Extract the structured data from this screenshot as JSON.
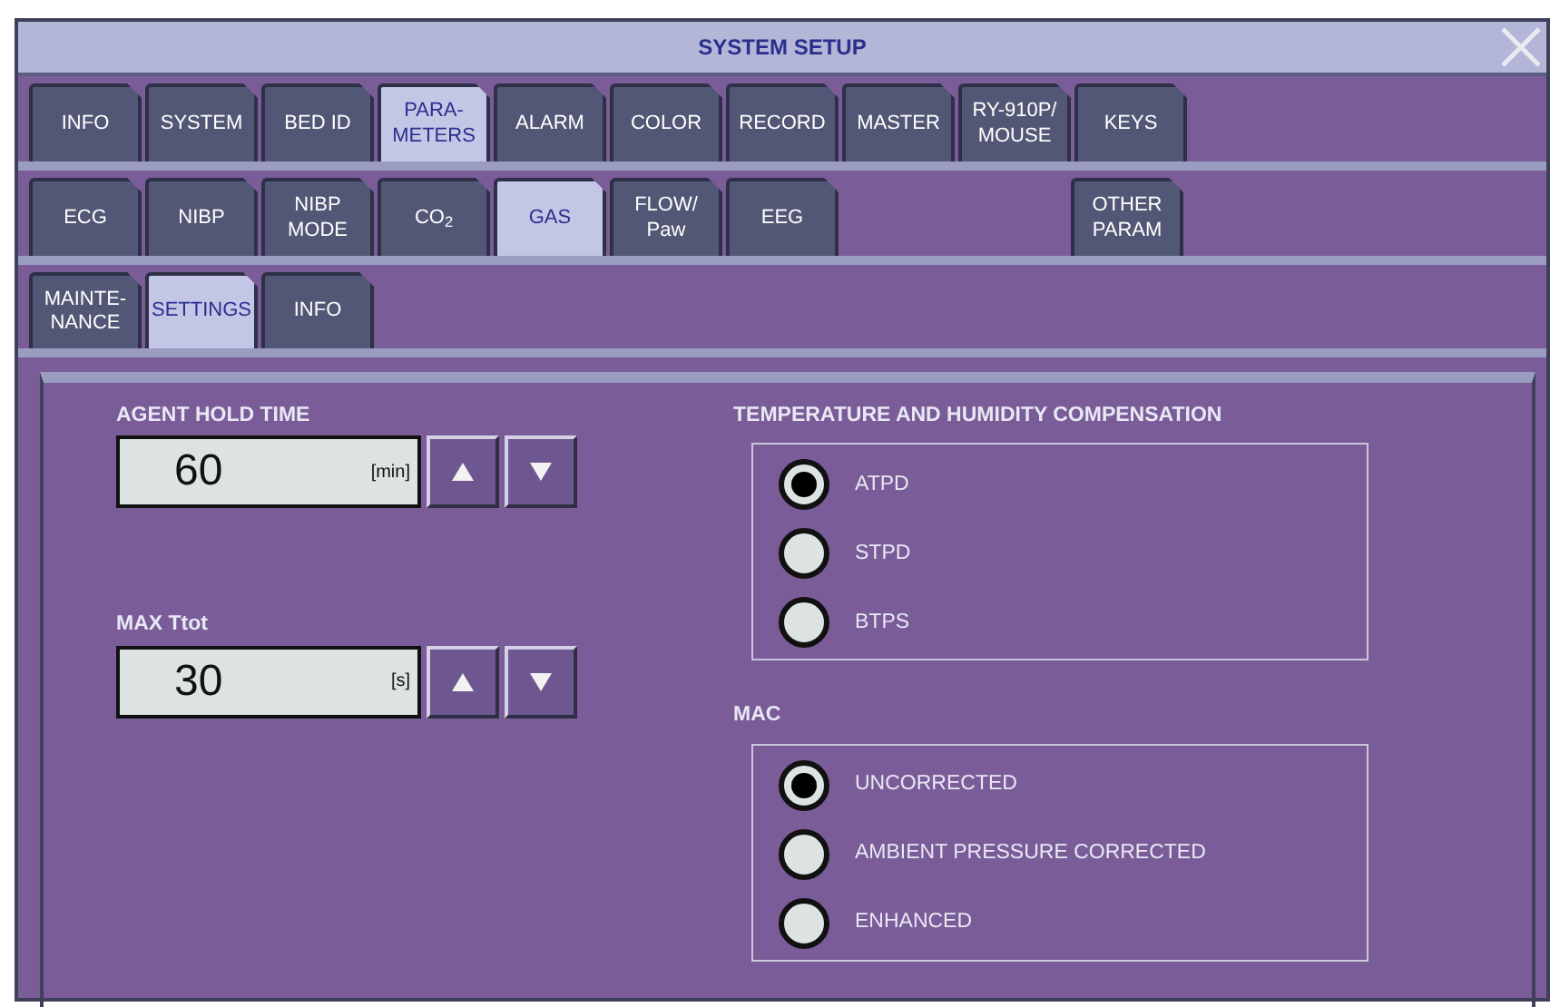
{
  "window": {
    "title": "SYSTEM SETUP"
  },
  "main_tabs": [
    {
      "label": "INFO",
      "selected": false
    },
    {
      "label": "SYSTEM",
      "selected": false
    },
    {
      "label": "BED ID",
      "selected": false
    },
    {
      "label": "PARA-\nMETERS",
      "selected": true
    },
    {
      "label": "ALARM",
      "selected": false
    },
    {
      "label": "COLOR",
      "selected": false
    },
    {
      "label": "RECORD",
      "selected": false
    },
    {
      "label": "MASTER",
      "selected": false
    },
    {
      "label": "RY-910P/\nMOUSE",
      "selected": false
    },
    {
      "label": "KEYS",
      "selected": false
    }
  ],
  "parameter_tabs": [
    {
      "kind": "tab",
      "label": "ECG",
      "selected": false
    },
    {
      "kind": "tab",
      "label": "NIBP",
      "selected": false
    },
    {
      "kind": "tab",
      "label": "NIBP\nMODE",
      "selected": false
    },
    {
      "kind": "tab",
      "label": "CO$_{2}$",
      "selected": false
    },
    {
      "kind": "tab",
      "label": "GAS",
      "selected": true
    },
    {
      "kind": "tab",
      "label": "FLOW/\nPaw",
      "selected": false
    },
    {
      "kind": "tab",
      "label": "EEG",
      "selected": false
    },
    {
      "kind": "gap"
    },
    {
      "kind": "tab",
      "label": "OTHER\nPARAM",
      "selected": false
    }
  ],
  "gas_tabs": [
    {
      "label": "MAINTE-\nNANCE",
      "selected": false
    },
    {
      "label": "SETTINGS",
      "selected": true
    },
    {
      "label": "INFO",
      "selected": false
    }
  ],
  "settings": [
    {
      "label": "AGENT HOLD TIME",
      "value": "60",
      "unit": "[min]"
    },
    {
      "label": "MAX Ttot",
      "value": "30",
      "unit": "[s]"
    }
  ],
  "option_groups": [
    {
      "title": "TEMPERATURE AND HUMIDITY COMPENSATION",
      "options": [
        {
          "label": "ATPD",
          "selected": true
        },
        {
          "label": "STPD",
          "selected": false
        },
        {
          "label": "BTPS",
          "selected": false
        }
      ]
    },
    {
      "title": "MAC",
      "options": [
        {
          "label": "UNCORRECTED",
          "selected": true
        },
        {
          "label": "AMBIENT PRESSURE CORRECTED",
          "selected": false
        },
        {
          "label": "ENHANCED",
          "selected": false
        }
      ]
    }
  ]
}
